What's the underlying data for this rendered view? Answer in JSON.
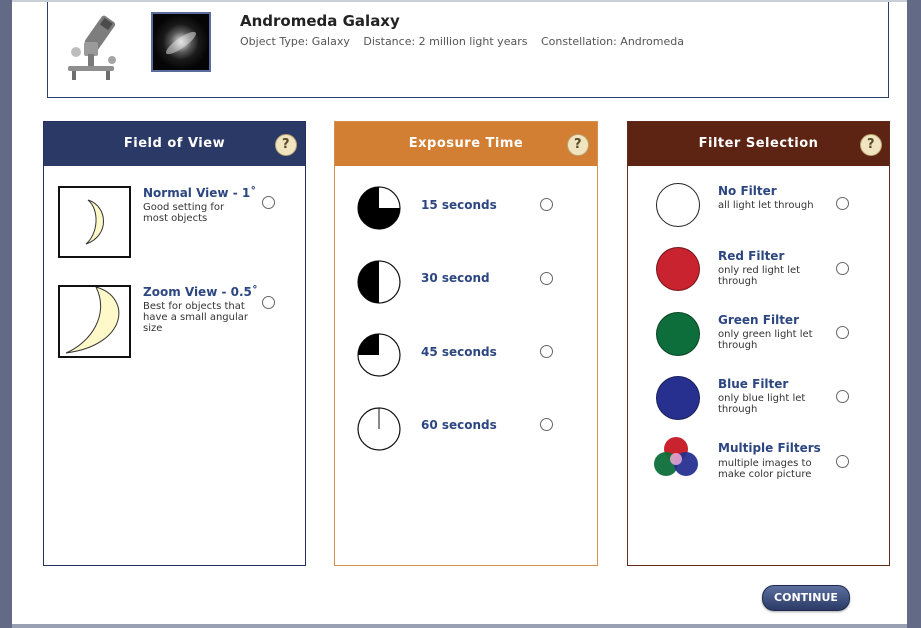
{
  "object": {
    "title": "Andromeda Galaxy",
    "type": "Object Type: Galaxy",
    "distance": "Distance: 2 million light years",
    "constellation": "Constellation: Andromeda"
  },
  "field_of_view": {
    "title": "Field of View",
    "help": "?",
    "options": [
      {
        "label": "Normal View - 1˚",
        "desc": "Good setting for most objects"
      },
      {
        "label": "Zoom View - 0.5˚",
        "desc": "Best for objects that have a small angular size"
      }
    ]
  },
  "exposure_time": {
    "title": "Exposure Time",
    "help": "?",
    "options": [
      {
        "label": "15 seconds",
        "filled_fraction": 0.75
      },
      {
        "label": "30 second",
        "filled_fraction": 0.5
      },
      {
        "label": "45 seconds",
        "filled_fraction": 0.25
      },
      {
        "label": "60 seconds",
        "filled_fraction": 0
      }
    ]
  },
  "filter_selection": {
    "title": "Filter Selection",
    "help": "?",
    "options": [
      {
        "label": "No Filter",
        "desc": "all light let through",
        "color": "#ffffff"
      },
      {
        "label": "Red Filter",
        "desc": "only red light let through",
        "color": "#c8232e"
      },
      {
        "label": "Green Filter",
        "desc": "only green light let through",
        "color": "#0e6e3b"
      },
      {
        "label": "Blue Filter",
        "desc": "only blue light let through",
        "color": "#27308f"
      },
      {
        "label": "Multiple Filters",
        "desc": "multiple images to make color picture",
        "color": "mixed"
      }
    ]
  },
  "continue_label": "CONTINUE",
  "colors": {
    "fov_header": "#2a3966",
    "exposure_header": "#d27f34",
    "filter_header": "#5e2413",
    "link_text": "#2c4680"
  }
}
